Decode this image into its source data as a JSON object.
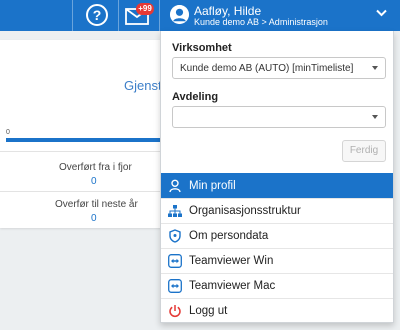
{
  "topbar": {
    "help_icon": "question-circle-icon",
    "mail_icon": "envelope-icon",
    "mail_badge": "+99",
    "user_name": "Aafløy, Hilde",
    "user_company": "Kunde demo AB > Administrasjon",
    "accent_color": "#1b73c9"
  },
  "background": {
    "title": "Gjenst",
    "zero_label": "0",
    "stats": [
      {
        "label": "Overført fra i fjor",
        "value": "0"
      },
      {
        "label": "Overfør til neste år",
        "value": "0"
      }
    ]
  },
  "panel": {
    "company_label": "Virksomhet",
    "company_value": "Kunde demo AB (AUTO) [minTimeliste]",
    "department_label": "Avdeling",
    "department_value": "",
    "done_button": "Ferdig"
  },
  "menu": [
    {
      "label": "Min profil",
      "icon": "user-profile-icon",
      "active": true
    },
    {
      "label": "Organisasjonsstruktur",
      "icon": "sitemap-icon",
      "active": false
    },
    {
      "label": "Om persondata",
      "icon": "data-privacy-icon",
      "active": false
    },
    {
      "label": "Teamviewer Win",
      "icon": "teamviewer-icon",
      "active": false
    },
    {
      "label": "Teamviewer Mac",
      "icon": "teamviewer-icon",
      "active": false
    },
    {
      "label": "Logg ut",
      "icon": "power-icon",
      "active": false
    }
  ]
}
